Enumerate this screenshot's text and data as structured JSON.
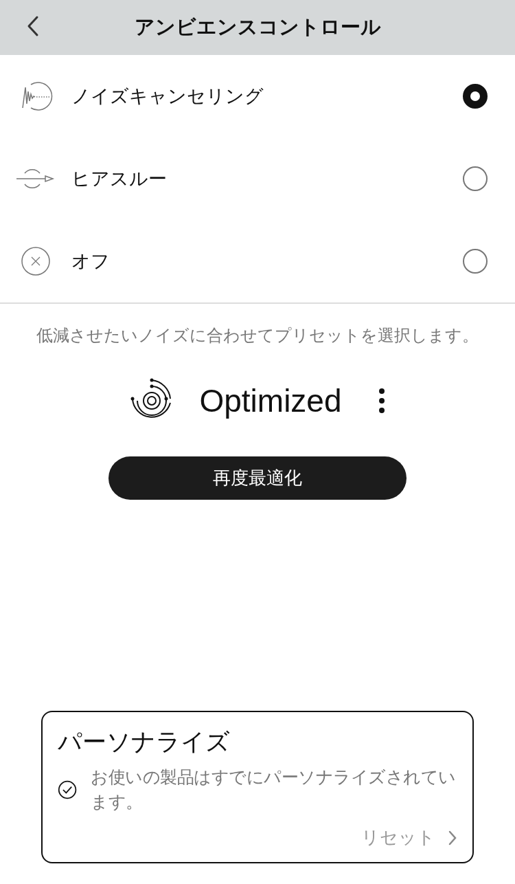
{
  "header": {
    "title": "アンビエンスコントロール"
  },
  "modes": [
    {
      "kind": "noise",
      "label": "ノイズキャンセリング",
      "selected": true
    },
    {
      "kind": "hear",
      "label": "ヒアスルー",
      "selected": false
    },
    {
      "kind": "off",
      "label": "オフ",
      "selected": false
    }
  ],
  "preset": {
    "hint": "低減させたいノイズに合わせてプリセットを選択します。",
    "name": "Optimized",
    "button": "再度最適化"
  },
  "personalize": {
    "title": "パーソナライズ",
    "message": "お使いの製品はすでにパーソナライズされています。",
    "link": "リセット"
  }
}
